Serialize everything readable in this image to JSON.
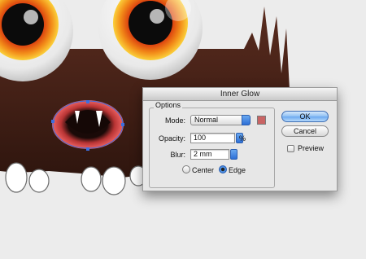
{
  "dialog": {
    "title": "Inner Glow",
    "options_label": "Options",
    "mode_label": "Mode:",
    "mode_value": "Normal",
    "glow_color": "#c96464",
    "opacity_label": "Opacity:",
    "opacity_value": "100",
    "opacity_unit": "%",
    "blur_label": "Blur:",
    "blur_value": "2 mm",
    "radio_center_label": "Center",
    "radio_edge_label": "Edge",
    "selected_source": "Edge",
    "ok_label": "OK",
    "cancel_label": "Cancel",
    "preview_label": "Preview",
    "preview_checked": false
  },
  "colors": {
    "canvas_bg": "#ececec",
    "fur": "#4a241a",
    "iris_outer": "#f29a1a",
    "iris_inner": "#e24a10",
    "mouth_glow": "#e85050",
    "selection_blue": "#3c6fe0"
  }
}
